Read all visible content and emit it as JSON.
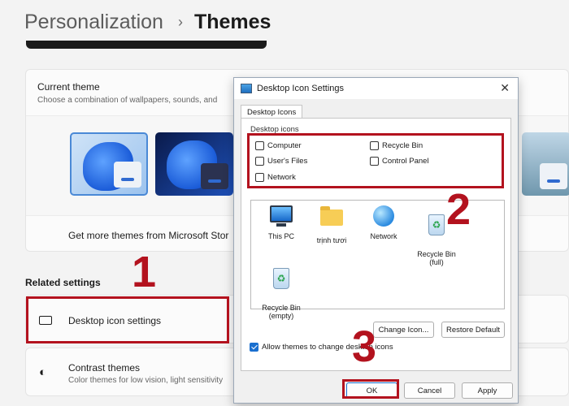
{
  "breadcrumb": {
    "parent": "Personalization",
    "separator": "›",
    "current": "Themes"
  },
  "current_theme": {
    "title": "Current theme",
    "subtitle": "Choose a combination of wallpapers, sounds, and"
  },
  "store_link": "Get more themes from Microsoft Stor",
  "related": {
    "heading": "Related settings",
    "items": [
      {
        "title": "Desktop icon settings",
        "subtitle": ""
      },
      {
        "title": "Contrast themes",
        "subtitle": "Color themes for low vision, light sensitivity"
      }
    ]
  },
  "annotations": {
    "step1": "1",
    "step2": "2",
    "step3": "3",
    "highlight_color": "#b3121e"
  },
  "dialog": {
    "title": "Desktop Icon Settings",
    "close": "✕",
    "tab": "Desktop Icons",
    "group_label": "Desktop icons",
    "checkboxes": [
      {
        "label": "Computer",
        "checked": false
      },
      {
        "label": "Recycle Bin",
        "checked": false
      },
      {
        "label": "User's Files",
        "checked": false
      },
      {
        "label": "Control Panel",
        "checked": false
      },
      {
        "label": "Network",
        "checked": false
      }
    ],
    "icons": [
      {
        "label": "This PC",
        "icon": "computer-icon"
      },
      {
        "label": "trịnh tươi",
        "icon": "folder-icon"
      },
      {
        "label": "Network",
        "icon": "network-icon"
      },
      {
        "label": "Recycle Bin\n(full)",
        "icon": "recycle-bin-full-icon"
      },
      {
        "label": "Recycle Bin\n(empty)",
        "icon": "recycle-bin-empty-icon"
      }
    ],
    "change_icon": "Change Icon...",
    "restore_default": "Restore Default",
    "allow_themes": "Allow themes to change desktop icons",
    "allow_checked": true,
    "ok": "OK",
    "cancel": "Cancel",
    "apply": "Apply"
  }
}
